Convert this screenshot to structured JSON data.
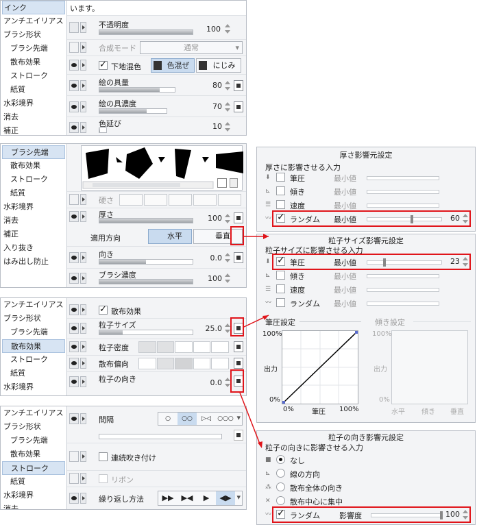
{
  "panel1": {
    "sidebar": [
      "インク",
      "アンチエイリアス",
      "ブラシ形状",
      "ブラシ先端",
      "散布効果",
      "ストローク",
      "紙質",
      "水彩境界",
      "消去",
      "補正"
    ],
    "top_text": "います。",
    "opacity_label": "不透明度",
    "opacity_value": "100",
    "opacity_level": 1.0,
    "blend_label": "合成モード",
    "blend_value": "通常",
    "underlay_label": "下地混色",
    "mix_label": "色混ぜ",
    "bleed_label": "にじみ",
    "paint_amount_label": "絵の具量",
    "paint_amount_value": "80",
    "paint_amount_level": 0.8,
    "paint_density_label": "絵の具濃度",
    "paint_density_value": "70",
    "paint_density_level": 0.7,
    "color_stretch_label": "色延び",
    "color_stretch_value": "10",
    "color_stretch_level": 0.1
  },
  "panel2": {
    "sidebar": [
      "ブラシ先端",
      "散布効果",
      "ストローク",
      "紙質",
      "水彩境界",
      "消去",
      "補正",
      "入り抜き",
      "はみ出し防止"
    ],
    "hardness_label": "硬さ",
    "thickness_label": "厚さ",
    "thickness_value": "100",
    "thickness_level": 1.0,
    "direction_label": "適用方向",
    "horizontal_label": "水平",
    "vertical_label": "垂直",
    "orientation_label": "向き",
    "orientation_value": "0.0",
    "orientation_level": 0.5,
    "brush_density_label": "ブラシ濃度",
    "brush_density_value": "100",
    "brush_density_level": 1.0
  },
  "panel3": {
    "sidebar": [
      "アンチエイリアス",
      "ブラシ形状",
      "ブラシ先端",
      "散布効果",
      "ストローク",
      "紙質",
      "水彩境界"
    ],
    "scatter_label": "散布効果",
    "particle_size_label": "粒子サイズ",
    "particle_size_value": "25.0",
    "particle_size_level": 0.25,
    "particle_density_label": "粒子密度",
    "scatter_bias_label": "散布偏向",
    "particle_dir_label": "粒子の向き",
    "particle_dir_value": "0.0"
  },
  "panel4": {
    "sidebar": [
      "アンチエイリアス",
      "ブラシ形状",
      "ブラシ先端",
      "散布効果",
      "ストローク",
      "紙質",
      "水彩境界",
      "消去"
    ],
    "interval_label": "間隔",
    "continuous_label": "連続吹き付け",
    "ribbon_label": "リボン",
    "repeat_label": "繰り返し方法"
  },
  "dialog1": {
    "title": "厚さ影響元設定",
    "subtitle": "厚さに影響させる入力",
    "rows": [
      {
        "name": "筆圧",
        "min": "最小値",
        "checked": false,
        "value": ""
      },
      {
        "name": "傾き",
        "min": "最小値",
        "checked": false,
        "value": ""
      },
      {
        "name": "速度",
        "min": "最小値",
        "checked": false,
        "value": ""
      },
      {
        "name": "ランダム",
        "min": "最小値",
        "checked": true,
        "value": "60",
        "level": 0.6
      }
    ]
  },
  "dialog2": {
    "title": "粒子サイズ影響元設定",
    "subtitle": "粒子サイズに影響させる入力",
    "rows": [
      {
        "name": "筆圧",
        "min": "最小値",
        "checked": true,
        "value": "23",
        "level": 0.23
      },
      {
        "name": "傾き",
        "min": "最小値",
        "checked": false,
        "value": ""
      },
      {
        "name": "速度",
        "min": "最小値",
        "checked": false,
        "value": ""
      },
      {
        "name": "ランダム",
        "min": "最小値",
        "checked": false,
        "value": ""
      }
    ],
    "pressure_section": "筆圧設定",
    "tilt_section": "傾き設定",
    "y_label": "出力",
    "pressure_graph": {
      "y_top": "100%",
      "y_bottom": "0%",
      "x_left": "0%",
      "x_mid": "筆圧",
      "x_right": "100%"
    },
    "tilt_graph": {
      "y_top": "100%",
      "y_bottom": "0%",
      "x_left": "水平",
      "x_mid": "傾き",
      "x_right": "垂直"
    }
  },
  "dialog3": {
    "title": "粒子の向き影響元設定",
    "subtitle": "粒子の向きに影響させる入力",
    "options": [
      "なし",
      "線の方向",
      "散布全体の向き",
      "散布中心に集中"
    ],
    "random_label": "ランダム",
    "influence_label": "影響度",
    "influence_value": "100",
    "influence_level": 1.0
  },
  "accent": "#e0141a"
}
